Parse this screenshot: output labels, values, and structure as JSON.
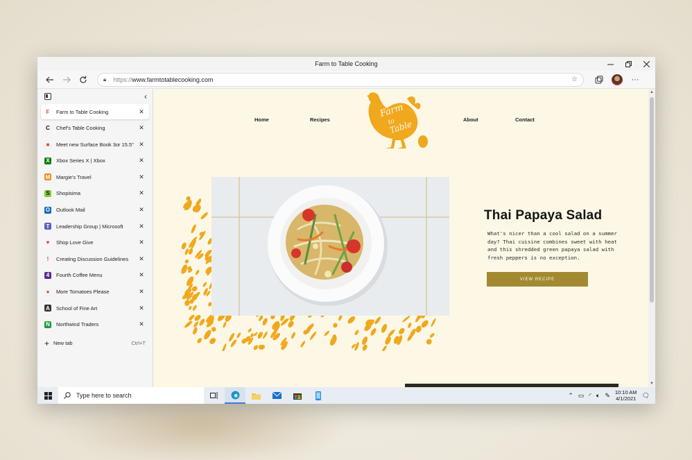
{
  "window": {
    "title": "Farm to Table Cooking"
  },
  "toolbar": {
    "url_protocol": "https://",
    "url_host": "www.farmtotablecooking.com"
  },
  "sidebar": {
    "tabs": [
      {
        "label": "Farm to Table Cooking",
        "icon": "farm-to-table-favicon",
        "fav_text": "F",
        "fav_color": "#e0512b",
        "fav_bg": "transparent",
        "active": true
      },
      {
        "label": "Chef's Table Cooking",
        "icon": "chefs-table-favicon",
        "fav_text": "C",
        "fav_color": "#111111",
        "fav_bg": "transparent"
      },
      {
        "label": "Meet new Surface Book 3or 15.5\"",
        "icon": "microsoft-favicon",
        "fav_text": "■",
        "fav_color": "#f25022",
        "fav_bg": "transparent"
      },
      {
        "label": "Xbox Series X | Xbox",
        "icon": "xbox-favicon",
        "fav_text": "X",
        "fav_color": "#ffffff",
        "fav_bg": "#107c10"
      },
      {
        "label": "Margie's Travel",
        "icon": "margies-travel-favicon",
        "fav_text": "M",
        "fav_color": "#ffffff",
        "fav_bg": "#f28c1a"
      },
      {
        "label": "Shopisima",
        "icon": "shopisima-favicon",
        "fav_text": "S",
        "fav_color": "#111111",
        "fav_bg": "#7fce3a"
      },
      {
        "label": "Outlook Mail",
        "icon": "outlook-favicon",
        "fav_text": "O",
        "fav_color": "#ffffff",
        "fav_bg": "#0f6cbd"
      },
      {
        "label": "Leadership Group | Microsoft",
        "icon": "teams-favicon",
        "fav_text": "T",
        "fav_color": "#ffffff",
        "fav_bg": "#5b5fc7"
      },
      {
        "label": "Shop Love Give",
        "icon": "heart-favicon",
        "fav_text": "♥",
        "fav_color": "#d63b3b",
        "fav_bg": "transparent"
      },
      {
        "label": "Creating Discussion Guidelines",
        "icon": "exclamation-favicon",
        "fav_text": "!",
        "fav_color": "#e0342b",
        "fav_bg": "transparent"
      },
      {
        "label": "Fourth Coffee Menu",
        "icon": "fourth-coffee-favicon",
        "fav_text": "4",
        "fav_color": "#ffffff",
        "fav_bg": "#5b2d8e"
      },
      {
        "label": "More Tomatoes Please",
        "icon": "tomato-favicon",
        "fav_text": "●",
        "fav_color": "#e04a1f",
        "fav_bg": "transparent"
      },
      {
        "label": "School of Fine Art",
        "icon": "fine-art-favicon",
        "fav_text": "A",
        "fav_color": "#ffffff",
        "fav_bg": "#333333"
      },
      {
        "label": "Northwind Traders",
        "icon": "northwind-favicon",
        "fav_text": "N",
        "fav_color": "#ffffff",
        "fav_bg": "#1d9b3a"
      }
    ],
    "new_tab_label": "New tab",
    "new_tab_shortcut": "Ctrl+T"
  },
  "site": {
    "nav": {
      "home": "Home",
      "recipes": "Recipes",
      "about": "About",
      "contact": "Contact"
    },
    "logo_text": [
      "Farm",
      "to",
      "Table"
    ],
    "brand_color": "#f0a81e",
    "hero": {
      "title": "Thai Papaya Salad",
      "description": "What's nicer than a cool salad on a summer day? Thai cuisine combines sweet with heat and this shredded green papaya salad with fresh peppers is no exception.",
      "cta": "VIEW RECIPE",
      "cta_color": "#a3892f"
    }
  },
  "taskbar": {
    "search_placeholder": "Type here to search",
    "time": "10:10 AM",
    "date": "4/1/2021"
  }
}
